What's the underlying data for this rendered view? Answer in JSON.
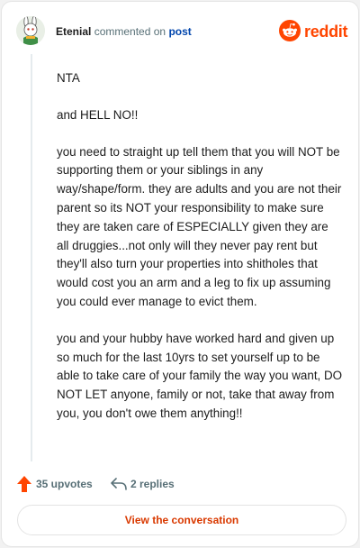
{
  "comment": {
    "author": "Etenial",
    "action_text": "commented on",
    "post_link": "post",
    "paragraphs": [
      "NTA",
      "and HELL NO!!",
      "you need to straight up tell them that you will NOT be supporting them or your siblings in any way/shape/form. they are adults and you are not their parent so its NOT your responsibility to make sure they are taken care of ESPECIALLY given they are all druggies...not only will they never pay rent but they'll also turn your properties into shitholes that would cost you an arm and a leg to fix up assuming you could ever manage to evict them.",
      "you and your hubby have worked hard and given up so much for the last 10yrs to set yourself up to be able to take care of your family the way you want, DO NOT LET anyone, family or not, take that away from you, you don't owe them anything!!"
    ],
    "upvotes_label": "35 upvotes",
    "replies_label": "2 replies"
  },
  "brand": {
    "name": "reddit",
    "icon": "reddit-logo-icon",
    "color": "#ff4500"
  },
  "avatar_icon": "snoo-avatar-icon",
  "footer": {
    "view_conversation_label": "View the conversation"
  },
  "colors": {
    "upvote": "#ff4500",
    "link": "#0045ac",
    "button_text": "#d93900"
  }
}
